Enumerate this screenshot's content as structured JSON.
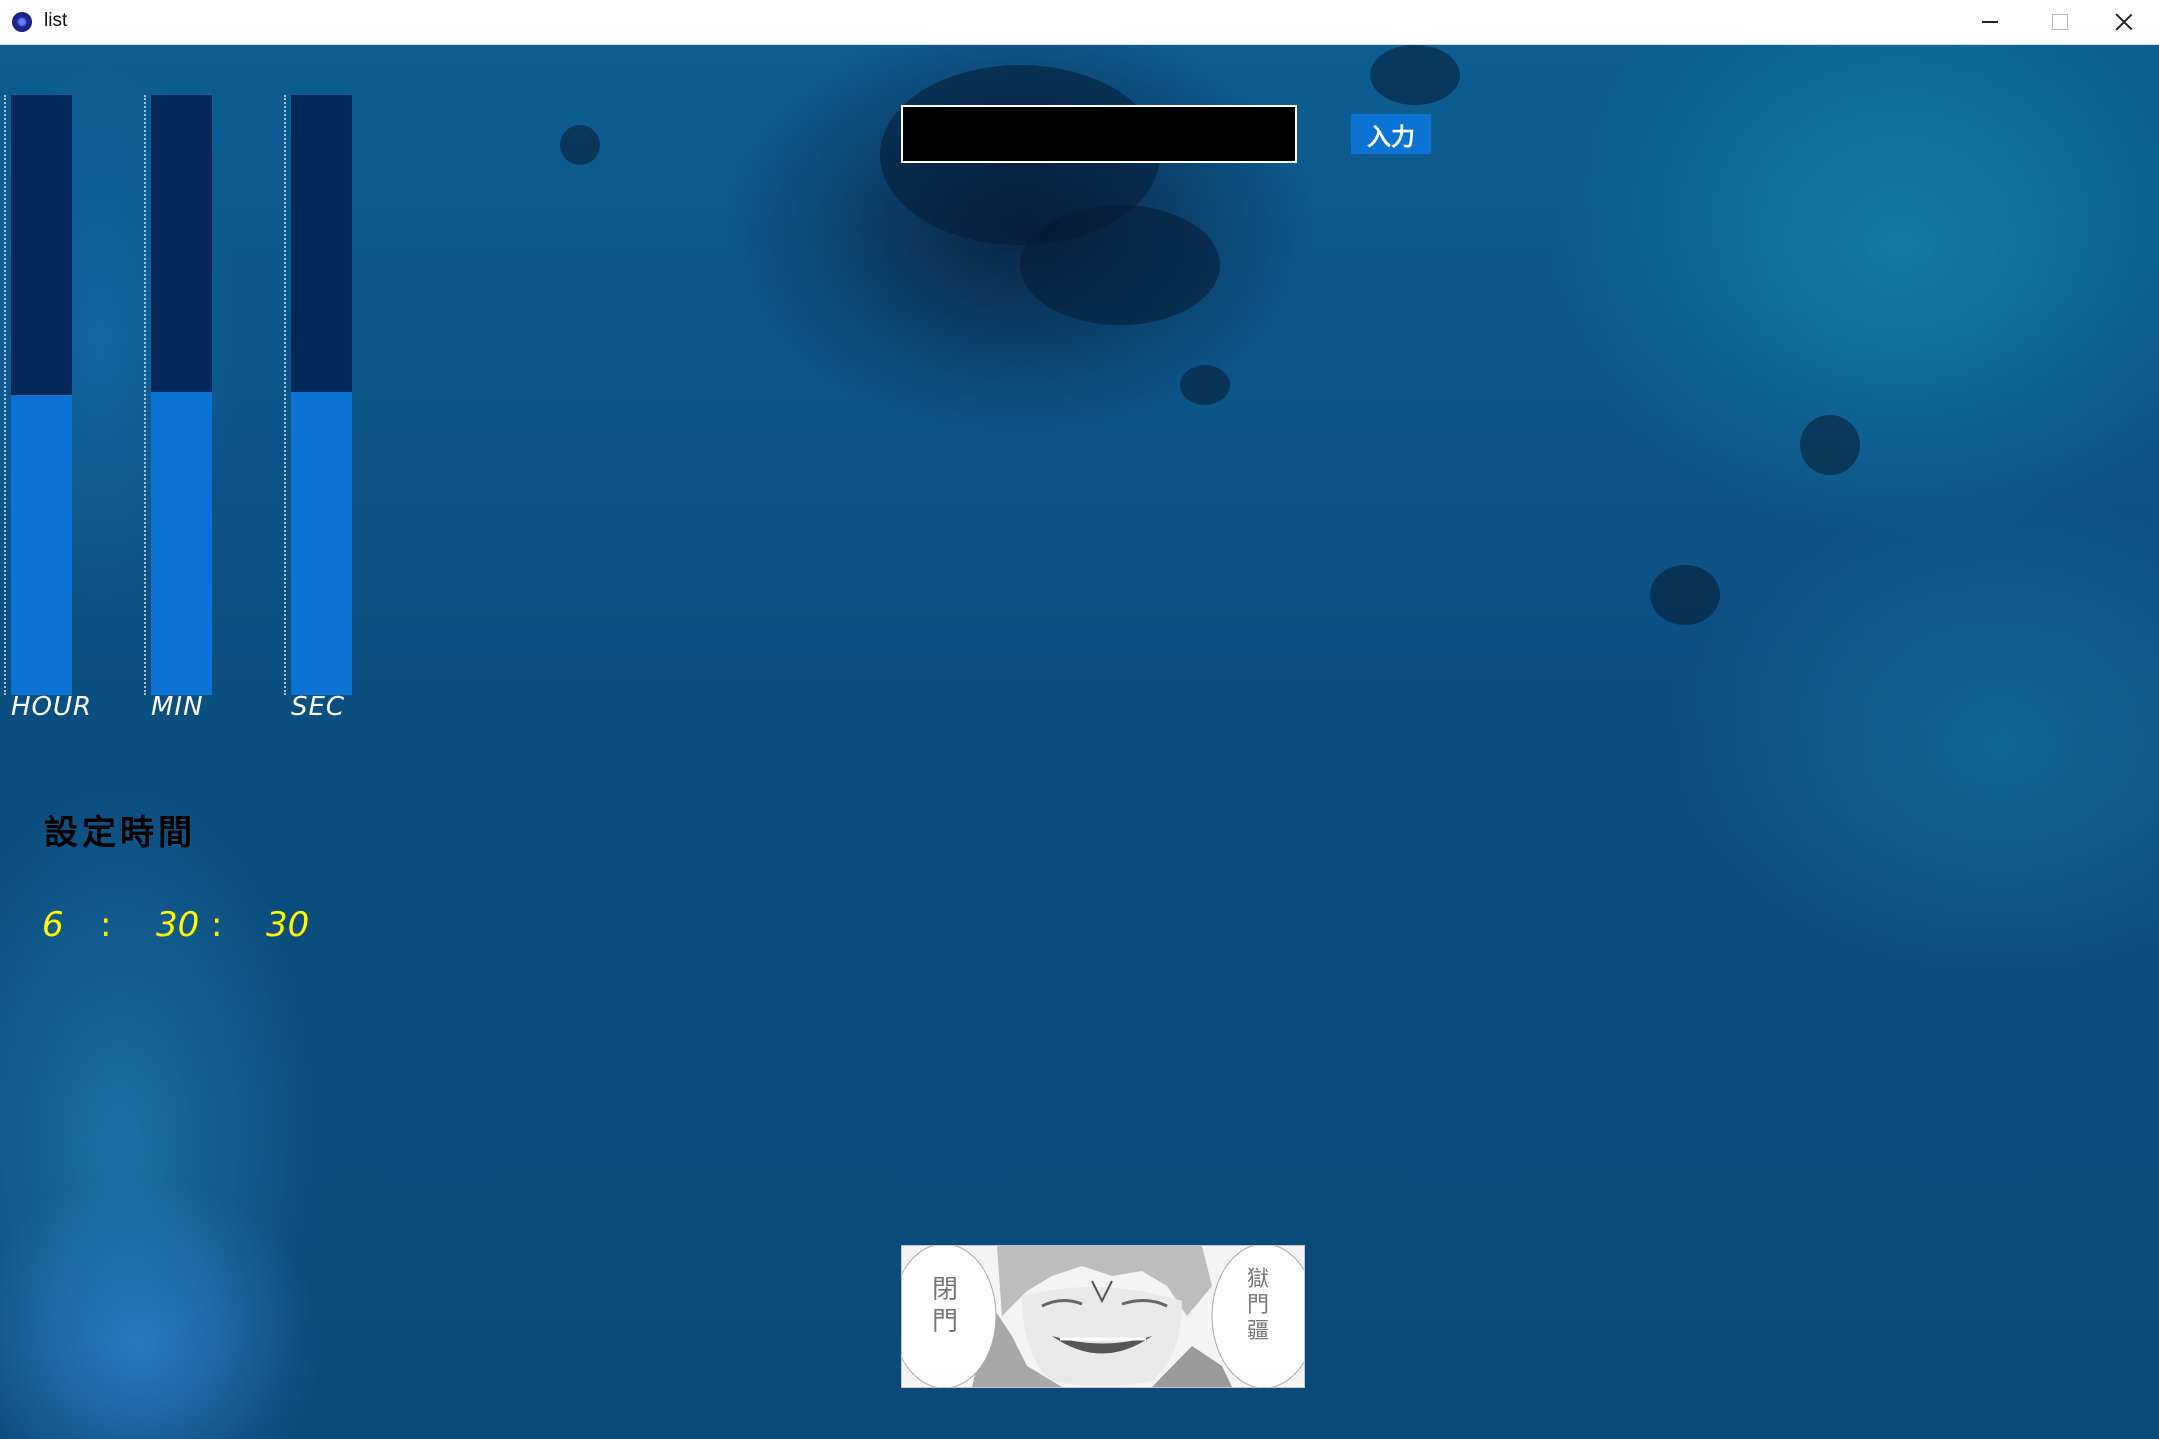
{
  "window": {
    "title": "list",
    "icon": "app-orb-icon"
  },
  "window_controls": [
    "minimize-icon",
    "maximize-icon",
    "close-icon"
  ],
  "bars": [
    {
      "label": "HOUR",
      "fill_fraction": 0.5
    },
    {
      "label": "MIN",
      "fill_fraction": 0.505
    },
    {
      "label": "SEC",
      "fill_fraction": 0.505
    }
  ],
  "setting": {
    "label": "設定時間",
    "hour": "6",
    "sep1": ":",
    "minute": "30",
    "sep2": ":",
    "second": "30"
  },
  "input": {
    "value": "",
    "placeholder": ""
  },
  "submit": {
    "label": "入力"
  },
  "manga": {
    "left_text": "閉門",
    "right_text": "獄門疆"
  },
  "colors": {
    "bar_track": "#04285a",
    "bar_fill": "#0a73d3",
    "time_text": "#ffff00",
    "button_bg": "#0a73d3"
  }
}
